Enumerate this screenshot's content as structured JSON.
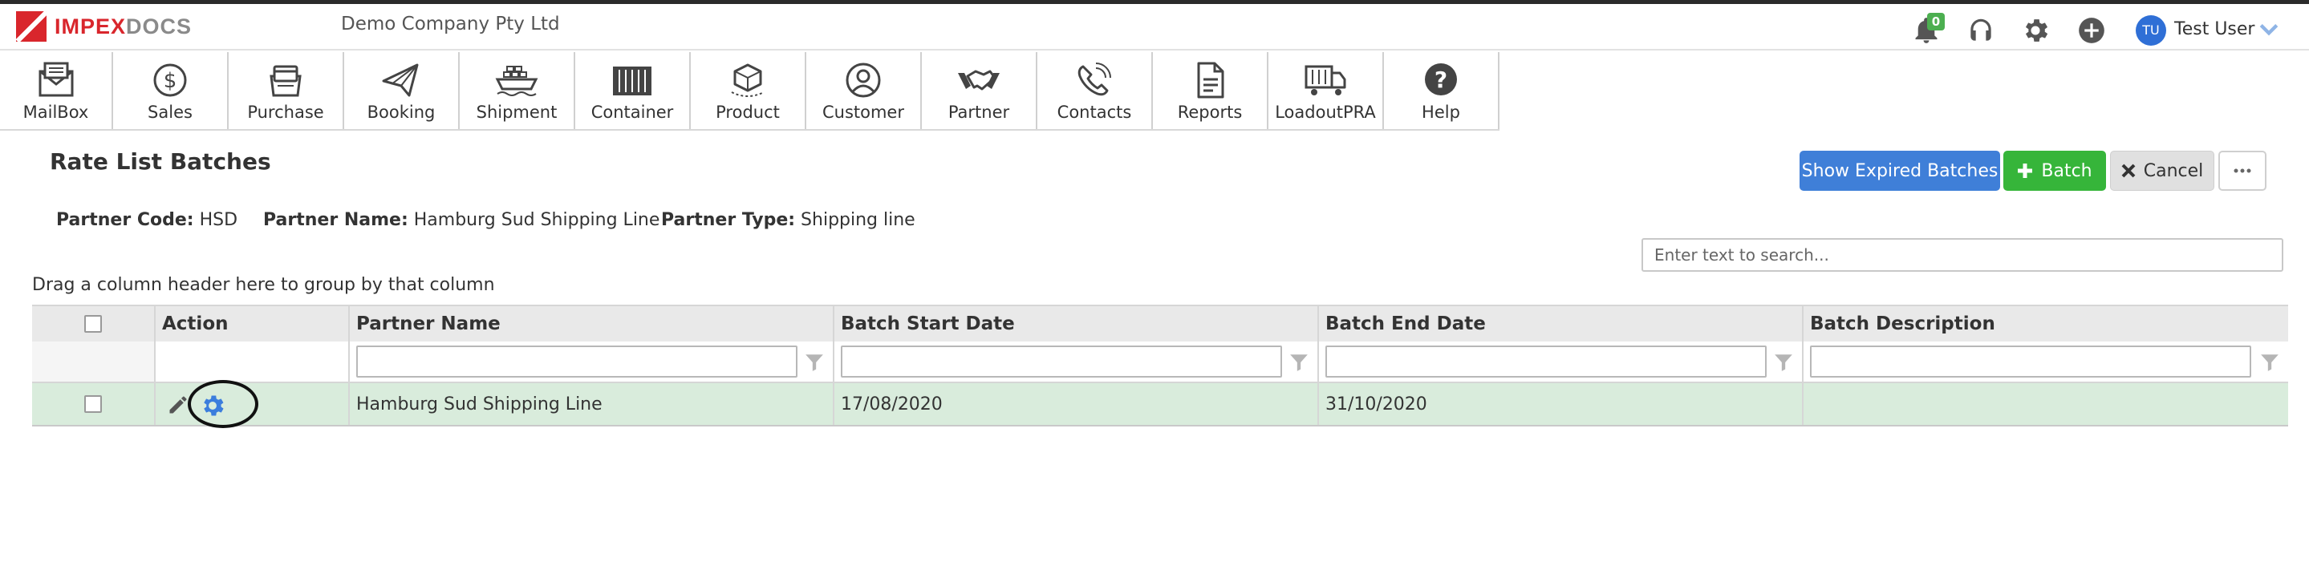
{
  "header": {
    "logo_part1": "IMPEX",
    "logo_part2": "DOCS",
    "company": "Demo Company Pty Ltd",
    "notification_count": "0",
    "user_initials": "TU",
    "user_name": "Test User"
  },
  "nav": {
    "items": [
      {
        "label": "MailBox",
        "icon": "mailbox-icon"
      },
      {
        "label": "Sales",
        "icon": "sales-icon"
      },
      {
        "label": "Purchase",
        "icon": "purchase-icon"
      },
      {
        "label": "Booking",
        "icon": "booking-icon"
      },
      {
        "label": "Shipment",
        "icon": "shipment-icon"
      },
      {
        "label": "Container",
        "icon": "container-icon"
      },
      {
        "label": "Product",
        "icon": "product-icon"
      },
      {
        "label": "Customer",
        "icon": "customer-icon"
      },
      {
        "label": "Partner",
        "icon": "partner-icon"
      },
      {
        "label": "Contacts",
        "icon": "contacts-icon"
      },
      {
        "label": "Reports",
        "icon": "reports-icon"
      },
      {
        "label": "LoadoutPRA",
        "icon": "loadout-icon"
      },
      {
        "label": "Help",
        "icon": "help-icon"
      }
    ]
  },
  "page": {
    "title": "Rate List Batches",
    "buttons": {
      "show_expired": "Show Expired Batches",
      "batch": "Batch",
      "cancel": "Cancel"
    },
    "info": {
      "partner_code_label": "Partner Code:",
      "partner_code": "HSD",
      "partner_name_label": "Partner Name:",
      "partner_name": "Hamburg Sud Shipping Line",
      "partner_type_label": "Partner Type:",
      "partner_type": "Shipping line"
    },
    "search_placeholder": "Enter text to search...",
    "group_hint": "Drag a column header here to group by that column"
  },
  "grid": {
    "columns": [
      "Action",
      "Partner Name",
      "Batch Start Date",
      "Batch End Date",
      "Batch Description"
    ],
    "rows": [
      {
        "partner_name": "Hamburg Sud Shipping Line",
        "start_date": "17/08/2020",
        "end_date": "31/10/2020",
        "description": ""
      }
    ]
  },
  "colors": {
    "brand_red": "#d9262c",
    "primary_blue": "#3f7fd8",
    "success_green": "#36b53a",
    "row_highlight": "#d9ecdc"
  }
}
